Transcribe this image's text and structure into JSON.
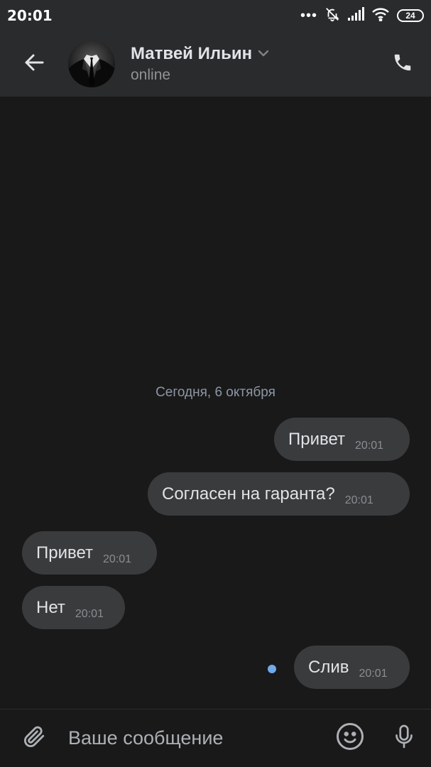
{
  "status_bar": {
    "time": "20:01",
    "dots": "•••",
    "battery": "24",
    "icons": [
      "mute-icon",
      "signal-icon",
      "wifi-icon",
      "battery-icon"
    ]
  },
  "header": {
    "name": "Матвей Ильин",
    "status": "online",
    "icons": [
      "back-arrow-icon",
      "chevron-down-icon",
      "phone-icon"
    ]
  },
  "chat": {
    "date_separator": "Сегодня, 6 октября",
    "messages": [
      {
        "side": "outgoing",
        "text": "Привет",
        "time": "20:01"
      },
      {
        "side": "outgoing",
        "text": "Согласен на гаранта?",
        "time": "20:01"
      },
      {
        "side": "incoming",
        "text": "Привет",
        "time": "20:01"
      },
      {
        "side": "incoming",
        "text": "Нет",
        "time": "20:01"
      },
      {
        "side": "outgoing",
        "text": "Слив",
        "time": "20:01",
        "unread": true
      }
    ]
  },
  "composer": {
    "placeholder": "Ваше сообщение",
    "icons": [
      "paperclip-icon",
      "smile-icon",
      "microphone-icon"
    ]
  },
  "colors": {
    "background": "#19191a",
    "header": "#2a2b2d",
    "bubble": "#3a3b3d",
    "accent_unread": "#71aaeb",
    "date_text": "#8d97a5"
  }
}
